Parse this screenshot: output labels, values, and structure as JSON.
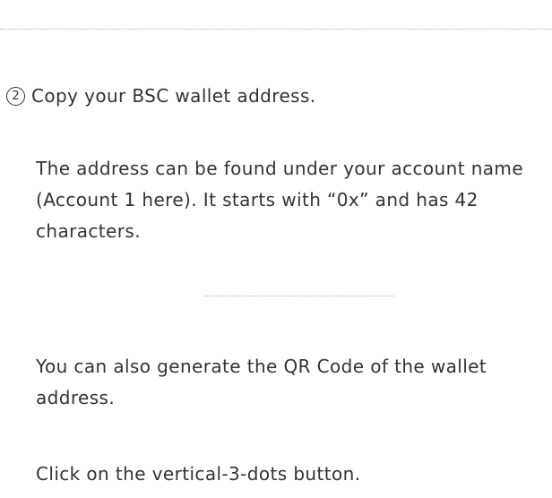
{
  "step": {
    "number": "2",
    "heading": "Copy your BSC wallet address."
  },
  "paragraphs": [
    "The address can be found under your account name (Account 1 here). It starts with “0x” and has 42 characters.",
    "You can also generate the QR Code of the wallet address.",
    "Click on the vertical-3-dots button."
  ]
}
